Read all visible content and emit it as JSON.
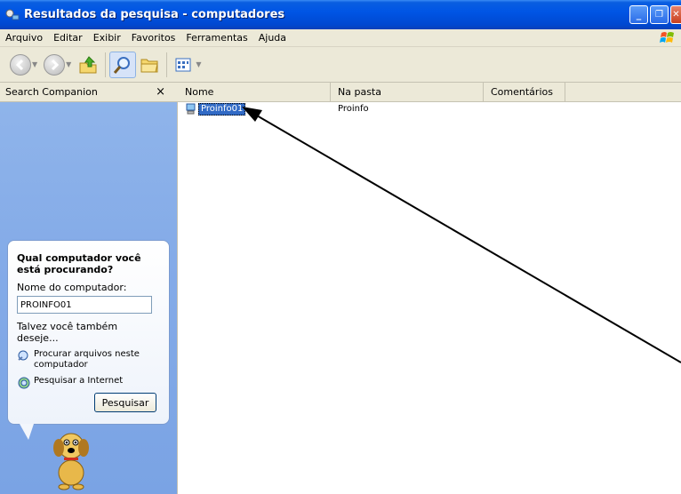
{
  "window": {
    "title": "Resultados da pesquisa - computadores",
    "controls": {
      "minimize": "_",
      "restore": "❐",
      "close": "✕"
    }
  },
  "menu": {
    "items": [
      "Arquivo",
      "Editar",
      "Exibir",
      "Favoritos",
      "Ferramentas",
      "Ajuda"
    ]
  },
  "toolbar": {
    "icons": [
      "back-icon",
      "forward-icon",
      "up-folder-icon",
      "search-icon",
      "folders-icon",
      "views-icon"
    ]
  },
  "search_companion": {
    "header": "Search Companion",
    "close": "×",
    "question": "Qual computador você está procurando?",
    "field_label": "Nome do computador:",
    "field_value": "PROINFO01",
    "maybe_label": "Talvez você também deseje...",
    "links": [
      {
        "text": "Procurar arquivos neste computador",
        "icon": "search-files-icon"
      },
      {
        "text": "Pesquisar a Internet",
        "icon": "search-internet-icon"
      }
    ],
    "button": "Pesquisar"
  },
  "results": {
    "columns": [
      "Nome",
      "Na pasta",
      "Comentários"
    ],
    "rows": [
      {
        "name": "Proinfo01",
        "folder": "Proinfo",
        "comment": ""
      }
    ]
  },
  "colors": {
    "title_bar": "#0055e5",
    "panel_blue": "#84abe8",
    "selection": "#316ac5",
    "chrome": "#ece9d8"
  }
}
